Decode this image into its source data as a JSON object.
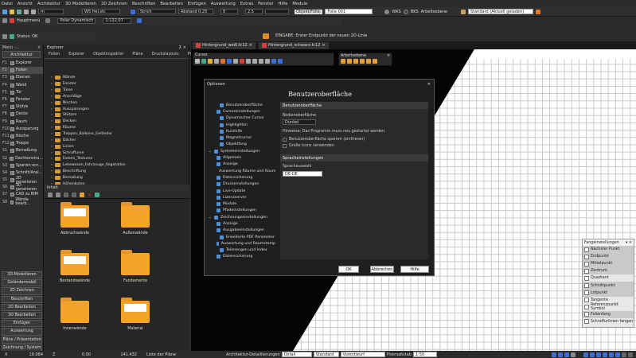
{
  "menu": [
    "Datei",
    "Ansicht",
    "Architektur",
    "3D Modellieren",
    "2D Zeichnen",
    "Beschriften",
    "Bearbeiten",
    "Einfügen",
    "Auswertung",
    "Extras",
    "Fenster",
    "Hilfe",
    "Module"
  ],
  "toolbar1": {
    "mode_value": "m",
    "ws": "WS frei.stc",
    "strich": "Strich",
    "abstand": "Abstand 0.25",
    "val0": "0",
    "val25": "2.5",
    "objekt_folie": "Objekt/Folie:",
    "folie": "Folie 001",
    "wks": "WKS",
    "bks": "BKS",
    "arbeitsebene": "Arbeitsebene",
    "standard": "Standard (Aktuell geladen)"
  },
  "toolbar2": {
    "hauptmenu": "Hauptmenü",
    "polar": "Polar Dynamisch",
    "scale": "1:122.07",
    "eingabe": "EINGABE: Erster Endpunkt der neuen 2D-Linie"
  },
  "toolbar3": {
    "status": "Status: OK"
  },
  "left": {
    "header": "Menü -...",
    "title": "Architektur",
    "items": [
      {
        "k": "F1",
        "l": "Explorer"
      },
      {
        "k": "F2",
        "l": "Folien"
      },
      {
        "k": "F3",
        "l": "Ebenen"
      },
      {
        "k": "F4",
        "l": "Wand"
      },
      {
        "k": "F5",
        "l": "Tür"
      },
      {
        "k": "F6",
        "l": "Fenster"
      },
      {
        "k": "F7",
        "l": "Stütze"
      },
      {
        "k": "F8",
        "l": "Decke"
      },
      {
        "k": "F9",
        "l": "Raum"
      },
      {
        "k": "F10",
        "l": "Aussparung"
      },
      {
        "k": "F11",
        "l": "Nische"
      },
      {
        "k": "F12",
        "l": "Treppe"
      },
      {
        "k": "S1",
        "l": "Bemaßung"
      },
      {
        "k": "S2",
        "l": "Dachkonstru..."
      },
      {
        "k": "S3",
        "l": "Sparren erz..."
      },
      {
        "k": "S4",
        "l": "Schnitt/Ansi..."
      },
      {
        "k": "S5",
        "l": "2D generieren"
      },
      {
        "k": "S6",
        "l": "3D generieren"
      },
      {
        "k": "S7",
        "l": "CAD zu BIM"
      },
      {
        "k": "S8",
        "l": "Wände bearb..."
      }
    ],
    "buttons": [
      "3D-Modellieren",
      "Geländemodell",
      "2D Zeichnen",
      "Beschriften",
      "2D Bearbeiten",
      "3D Bearbeiten",
      "Einfügen",
      "Auswertung",
      "Pläne / Präsentation",
      "Zeichnung / System"
    ]
  },
  "explorer": {
    "title": "Explorer",
    "tabs": [
      "Folien",
      "Explorer",
      "Objektinspektor",
      "Pläne",
      "Druckslayouts",
      "Projekt"
    ],
    "tree": [
      "Wände",
      "Fenster",
      "Türen",
      "Anschläge",
      "Nischen",
      "Aussparungen",
      "Stützen",
      "Decken",
      "Räume",
      "Treppen_Balkone_Geländer",
      "Dächer",
      "Linien",
      "Schraffuren",
      "Farben_Texturen",
      "Lebewesen_Fahrzeuge_Vegetation",
      "Beschriftung",
      "Bemaßung",
      "Höhenkoten"
    ],
    "inhalt": "Inhalt",
    "folders": [
      "Abbruchwände",
      "Außenwände",
      "Bestandswände",
      "Fundamente",
      "Innenwände",
      "Material"
    ]
  },
  "doc_tabs": [
    "Hintergrund_weiß.fc12",
    "Hintergrund_schwarz.fc12"
  ],
  "cursor_label": "Cursor",
  "arbeitsebene_label": "Arbeitsebene",
  "dialog": {
    "title": "Optionen",
    "heading": "Benutzeroberfläche",
    "tree": [
      {
        "l": "Benutzeroberfläche",
        "d": 2
      },
      {
        "l": "Cursoreinstellungen",
        "d": 1
      },
      {
        "l": "Dynamischer Cursor",
        "d": 2
      },
      {
        "l": "Highlighten",
        "d": 2
      },
      {
        "l": "Kurzhilfe",
        "d": 2
      },
      {
        "l": "Magnetcursor",
        "d": 2
      },
      {
        "l": "Objektfang",
        "d": 2
      },
      {
        "l": "Systemeinstellungen",
        "d": 0
      },
      {
        "l": "Allgemein",
        "d": 1
      },
      {
        "l": "Anzeige",
        "d": 1
      },
      {
        "l": "Auswertung Räume und Raum",
        "d": 1
      },
      {
        "l": "Datensicherung",
        "d": 1
      },
      {
        "l": "Druckeinstellungen",
        "d": 1
      },
      {
        "l": "Live-Update",
        "d": 1
      },
      {
        "l": "Lizenzserver",
        "d": 1
      },
      {
        "l": "Module",
        "d": 1
      },
      {
        "l": "Pfadeinstellungen",
        "d": 1
      },
      {
        "l": "Zeichnungseinstellungen",
        "d": 0
      },
      {
        "l": "Anzeige",
        "d": 1
      },
      {
        "l": "Ausgabeeinstellungen",
        "d": 1
      },
      {
        "l": "Erweiterte PDF Parameter",
        "d": 2
      },
      {
        "l": "Auswertung und Raumstemp",
        "d": 1
      },
      {
        "l": "Teilmengen und Index",
        "d": 2
      },
      {
        "l": "Datensicherung",
        "d": 1
      }
    ],
    "section1": "Benutzeroberfläche",
    "bedien_label": "Bedienoberfläche",
    "bedien_value": "Dunkel",
    "hinweis": "Hinweise: Das Programm muss neu gestartet werden.",
    "cb1": "Benutzeroberfläche sperren (einfrieren)",
    "cb2": "Große Icons verwenden",
    "section2": "Spracheinstellungen",
    "sprach_label": "Sprachauswahl",
    "sprach_value": "DE-DE",
    "ok": "OK",
    "abbrechen": "Abbrechen",
    "hilfe": "Hilfe"
  },
  "snap": {
    "title": "Fangeinstellungen",
    "items": [
      {
        "l": "Nächster Punkt",
        "s": true
      },
      {
        "l": "Endpunkt",
        "s": true
      },
      {
        "l": "Mittelpunkt",
        "s": true
      },
      {
        "l": "Zentrum",
        "s": true
      },
      {
        "l": "Quadrant",
        "s": false
      },
      {
        "l": "Schnittpunkt",
        "s": true
      },
      {
        "l": "Lotpunkt",
        "s": true
      },
      {
        "l": "Tangente",
        "s": false
      },
      {
        "l": "Referenzpunkt Symbol",
        "s": false
      },
      {
        "l": "Folienfang",
        "s": true
      },
      {
        "l": "Schraffurlinien fangen",
        "s": false
      }
    ]
  },
  "status": {
    "x_label": "X",
    "x": "19.084",
    "z_label": "Z",
    "z": "0.00",
    "y": "141.432",
    "rel": "Liste der Pläne",
    "detail_label": "Architektur-Detaillierungen",
    "detail": "Detail",
    "standard": "Standard",
    "vorentwurf": "Vorentwurf",
    "massstab_label": "Plotmaßstab",
    "massstab": "1:50"
  }
}
